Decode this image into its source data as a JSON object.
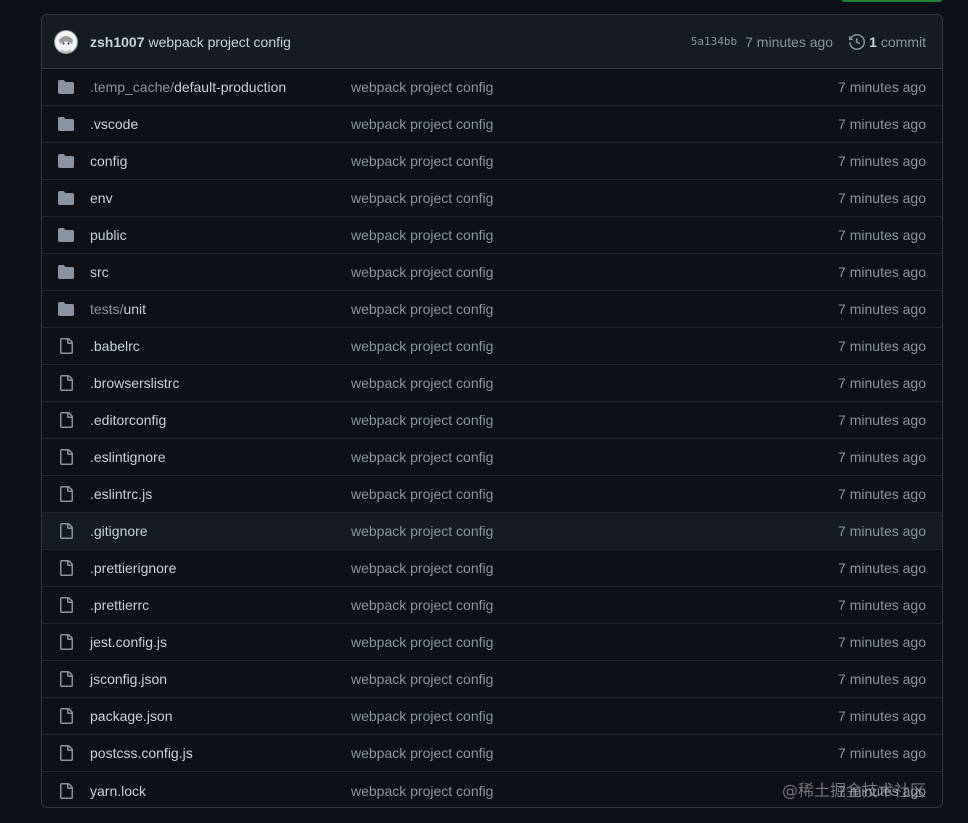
{
  "header": {
    "author": "zsh1007",
    "message": "webpack project config",
    "sha": "5a134bb",
    "time": "7 minutes ago",
    "commit_count": "1",
    "commit_label": "commit"
  },
  "files": [
    {
      "type": "dir",
      "prefix": ".temp_cache/",
      "name": "default-production",
      "commit": "webpack project config",
      "time": "7 minutes ago"
    },
    {
      "type": "dir",
      "prefix": "",
      "name": ".vscode",
      "commit": "webpack project config",
      "time": "7 minutes ago"
    },
    {
      "type": "dir",
      "prefix": "",
      "name": "config",
      "commit": "webpack project config",
      "time": "7 minutes ago"
    },
    {
      "type": "dir",
      "prefix": "",
      "name": "env",
      "commit": "webpack project config",
      "time": "7 minutes ago"
    },
    {
      "type": "dir",
      "prefix": "",
      "name": "public",
      "commit": "webpack project config",
      "time": "7 minutes ago"
    },
    {
      "type": "dir",
      "prefix": "",
      "name": "src",
      "commit": "webpack project config",
      "time": "7 minutes ago"
    },
    {
      "type": "dir",
      "prefix": "tests/",
      "name": "unit",
      "commit": "webpack project config",
      "time": "7 minutes ago"
    },
    {
      "type": "file",
      "prefix": "",
      "name": ".babelrc",
      "commit": "webpack project config",
      "time": "7 minutes ago"
    },
    {
      "type": "file",
      "prefix": "",
      "name": ".browserslistrc",
      "commit": "webpack project config",
      "time": "7 minutes ago"
    },
    {
      "type": "file",
      "prefix": "",
      "name": ".editorconfig",
      "commit": "webpack project config",
      "time": "7 minutes ago"
    },
    {
      "type": "file",
      "prefix": "",
      "name": ".eslintignore",
      "commit": "webpack project config",
      "time": "7 minutes ago"
    },
    {
      "type": "file",
      "prefix": "",
      "name": ".eslintrc.js",
      "commit": "webpack project config",
      "time": "7 minutes ago"
    },
    {
      "type": "file",
      "prefix": "",
      "name": ".gitignore",
      "commit": "webpack project config",
      "time": "7 minutes ago",
      "hover": true
    },
    {
      "type": "file",
      "prefix": "",
      "name": ".prettierignore",
      "commit": "webpack project config",
      "time": "7 minutes ago"
    },
    {
      "type": "file",
      "prefix": "",
      "name": ".prettierrc",
      "commit": "webpack project config",
      "time": "7 minutes ago"
    },
    {
      "type": "file",
      "prefix": "",
      "name": "jest.config.js",
      "commit": "webpack project config",
      "time": "7 minutes ago"
    },
    {
      "type": "file",
      "prefix": "",
      "name": "jsconfig.json",
      "commit": "webpack project config",
      "time": "7 minutes ago"
    },
    {
      "type": "file",
      "prefix": "",
      "name": "package.json",
      "commit": "webpack project config",
      "time": "7 minutes ago"
    },
    {
      "type": "file",
      "prefix": "",
      "name": "postcss.config.js",
      "commit": "webpack project config",
      "time": "7 minutes ago"
    },
    {
      "type": "file",
      "prefix": "",
      "name": "yarn.lock",
      "commit": "webpack project config",
      "time": "7 minutes ago"
    }
  ],
  "watermark": "@稀土掘金技术社区",
  "colors": {
    "background": "#0d1117",
    "header_bg": "#161b22",
    "border": "#30363d",
    "text": "#c9d1d9",
    "muted": "#8b949e",
    "icon": "#8b949e",
    "accent": "#238636"
  },
  "icons": {
    "dir": "folder-icon",
    "file": "file-icon",
    "history": "history-icon"
  }
}
